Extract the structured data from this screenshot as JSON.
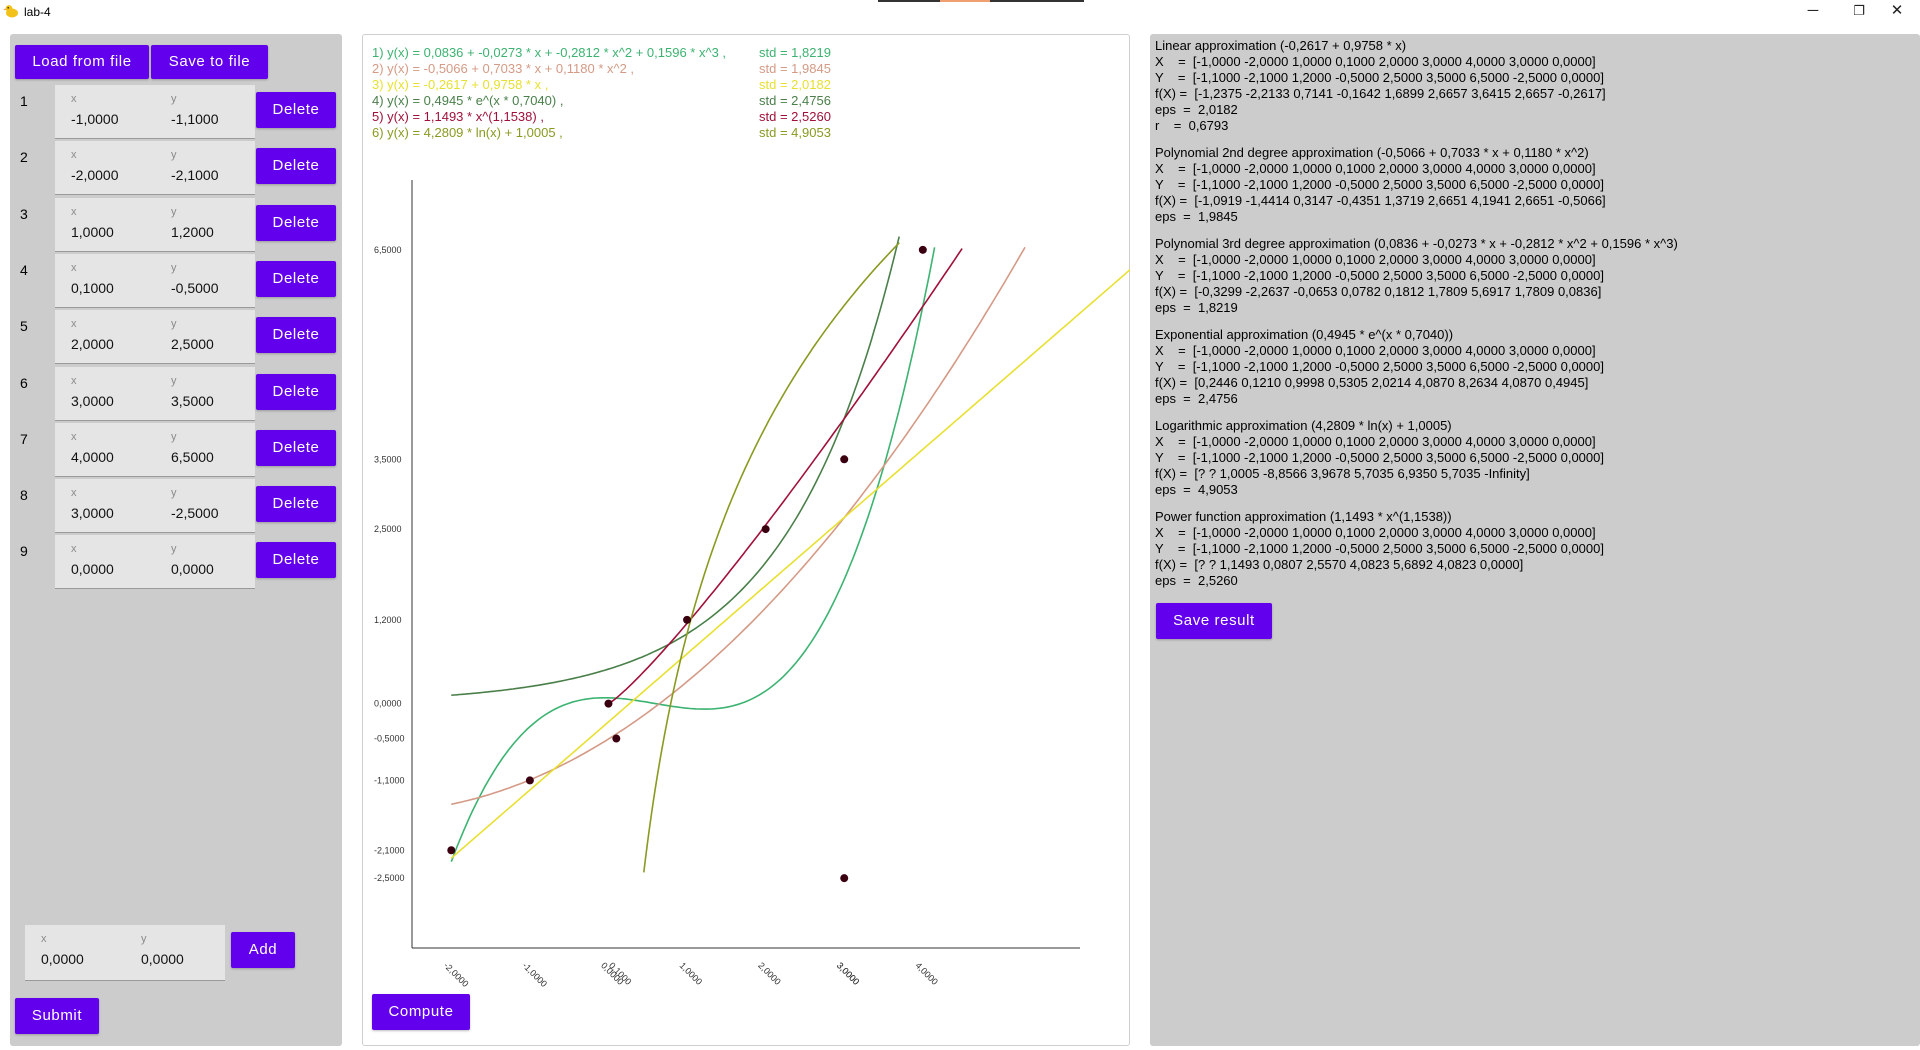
{
  "window": {
    "title": "lab-4",
    "minimize_glyph": "─",
    "restore_glyph": "❐",
    "close_glyph": "✕",
    "app_icon": "duck-icon"
  },
  "left": {
    "load_label": "Load from file",
    "save_label": "Save to file",
    "x_label": "x",
    "y_label": "y",
    "delete_label": "Delete",
    "points": [
      {
        "n": "1",
        "x": "-1,0000",
        "y": "-1,1000"
      },
      {
        "n": "2",
        "x": "-2,0000",
        "y": "-2,1000"
      },
      {
        "n": "3",
        "x": "1,0000",
        "y": "1,2000"
      },
      {
        "n": "4",
        "x": "0,1000",
        "y": "-0,5000"
      },
      {
        "n": "5",
        "x": "2,0000",
        "y": "2,5000"
      },
      {
        "n": "6",
        "x": "3,0000",
        "y": "3,5000"
      },
      {
        "n": "7",
        "x": "4,0000",
        "y": "6,5000"
      },
      {
        "n": "8",
        "x": "3,0000",
        "y": "-2,5000"
      },
      {
        "n": "9",
        "x": "0,0000",
        "y": "0,0000"
      }
    ],
    "new_x": "0,0000",
    "new_y": "0,0000",
    "add_label": "Add",
    "submit_label": "Submit"
  },
  "middle": {
    "legend": [
      {
        "formula": "1) y(x) = 0,0836 + -0,0273 * x + -0,2812 * x^2 + 0,1596 * x^3 ,",
        "std": "std = 1,8219",
        "color": "#3cb371"
      },
      {
        "formula": "2) y(x) = -0,5066 + 0,7033 * x + 0,1180 * x^2 ,",
        "std": "std = 1,9845",
        "color": "#d49a86"
      },
      {
        "formula": "3) y(x) = -0,2617 + 0,9758 * x ,",
        "std": "std = 2,0182",
        "color": "#e8e030"
      },
      {
        "formula": "4) y(x) = 0,4945 * e^(x * 0,7040) ,",
        "std": "std = 2,4756",
        "color": "#4a7f4a"
      },
      {
        "formula": "5) y(x) = 1,1493 * x^(1,1538) ,",
        "std": "std = 2,5260",
        "color": "#a0103a"
      },
      {
        "formula": "6) y(x) = 4,2809 * ln(x) + 1,0005 ,",
        "std": "std = 4,9053",
        "color": "#8a9a20"
      }
    ],
    "compute_label": "Compute"
  },
  "chart_data": {
    "type": "scatter",
    "points": [
      {
        "x": -1,
        "y": -1.1
      },
      {
        "x": -2,
        "y": -2.1
      },
      {
        "x": 1,
        "y": 1.2
      },
      {
        "x": 0.1,
        "y": -0.5
      },
      {
        "x": 2,
        "y": 2.5
      },
      {
        "x": 3,
        "y": 3.5
      },
      {
        "x": 4,
        "y": 6.5
      },
      {
        "x": 3,
        "y": -2.5
      },
      {
        "x": 0,
        "y": 0
      }
    ],
    "x_ticks": [
      "-2,0000",
      "-1,0000",
      "0,1000",
      "0,0000",
      "1,0000",
      "2,0000",
      "3,0000",
      "3,0000",
      "4,0000"
    ],
    "x_tick_values": [
      -2,
      -1,
      0.1,
      0,
      1,
      2,
      3,
      3,
      4
    ],
    "y_ticks": [
      "6,5000",
      "3,5000",
      "2,5000",
      "1,2000",
      "0,0000",
      "-0,5000",
      "-1,1000",
      "-2,1000",
      "-2,5000"
    ],
    "y_tick_values": [
      6.5,
      3.5,
      2.5,
      1.2,
      0,
      -0.5,
      -1.1,
      -2.1,
      -2.5
    ],
    "xlim": [
      -2.5,
      6
    ],
    "ylim": [
      -3.5,
      7.5
    ],
    "series": [
      {
        "color": "#3cb371",
        "kind": "poly3",
        "coef": [
          0.0836,
          -0.0273,
          -0.2812,
          0.1596
        ],
        "range": [
          -2,
          4.15
        ]
      },
      {
        "color": "#d49a86",
        "kind": "poly2",
        "coef": [
          -0.5066,
          0.7033,
          0.118
        ],
        "range": [
          -2,
          5.3
        ]
      },
      {
        "color": "#e8e030",
        "kind": "linear",
        "coef": [
          -0.2617,
          0.9758
        ],
        "range": [
          -2,
          7
        ]
      },
      {
        "color": "#4a7f4a",
        "kind": "exp",
        "coef": [
          0.4945,
          0.704
        ],
        "range": [
          -2,
          3.7
        ]
      },
      {
        "color": "#a0103a",
        "kind": "power",
        "coef": [
          1.1493,
          1.1538
        ],
        "range": [
          0,
          4.5
        ]
      },
      {
        "color": "#8a9a20",
        "kind": "log",
        "coef": [
          4.2809,
          1.0005
        ],
        "range": [
          0.45,
          3.7
        ]
      }
    ],
    "point_color": "#3a0010"
  },
  "right": {
    "blocks": [
      {
        "lines": [
          "Linear approximation (-0,2617 + 0,9758 * x)",
          "X    =  [-1,0000 -2,0000 1,0000 0,1000 2,0000 3,0000 4,0000 3,0000 0,0000]",
          "Y    =  [-1,1000 -2,1000 1,2000 -0,5000 2,5000 3,5000 6,5000 -2,5000 0,0000]",
          "f(X) =  [-1,2375 -2,2133 0,7141 -0,1642 1,6899 2,6657 3,6415 2,6657 -0,2617]",
          "eps  =  2,0182",
          "r    =  0,6793"
        ]
      },
      {
        "lines": [
          "Polynomial 2nd degree approximation (-0,5066 + 0,7033 * x + 0,1180 * x^2)",
          "X    =  [-1,0000 -2,0000 1,0000 0,1000 2,0000 3,0000 4,0000 3,0000 0,0000]",
          "Y    =  [-1,1000 -2,1000 1,2000 -0,5000 2,5000 3,5000 6,5000 -2,5000 0,0000]",
          "f(X) =  [-1,0919 -1,4414 0,3147 -0,4351 1,3719 2,6651 4,1941 2,6651 -0,5066]",
          "eps  =  1,9845"
        ]
      },
      {
        "lines": [
          "Polynomial 3rd degree approximation (0,0836 + -0,0273 * x + -0,2812 * x^2 + 0,1596 * x^3)",
          "X    =  [-1,0000 -2,0000 1,0000 0,1000 2,0000 3,0000 4,0000 3,0000 0,0000]",
          "Y    =  [-1,1000 -2,1000 1,2000 -0,5000 2,5000 3,5000 6,5000 -2,5000 0,0000]",
          "f(X) =  [-0,3299 -2,2637 -0,0653 0,0782 0,1812 1,7809 5,6917 1,7809 0,0836]",
          "eps  =  1,8219"
        ]
      },
      {
        "lines": [
          "Exponential approximation (0,4945 * e^(x * 0,7040))",
          "X    =  [-1,0000 -2,0000 1,0000 0,1000 2,0000 3,0000 4,0000 3,0000 0,0000]",
          "Y    =  [-1,1000 -2,1000 1,2000 -0,5000 2,5000 3,5000 6,5000 -2,5000 0,0000]",
          "f(X) =  [0,2446 0,1210 0,9998 0,5305 2,0214 4,0870 8,2634 4,0870 0,4945]",
          "eps  =  2,4756"
        ]
      },
      {
        "lines": [
          "Logarithmic approximation (4,2809 * ln(x) + 1,0005)",
          "X    =  [-1,0000 -2,0000 1,0000 0,1000 2,0000 3,0000 4,0000 3,0000 0,0000]",
          "Y    =  [-1,1000 -2,1000 1,2000 -0,5000 2,5000 3,5000 6,5000 -2,5000 0,0000]",
          "f(X) =  [? ? 1,0005 -8,8566 3,9678 5,7035 6,9350 5,7035 -Infinity]",
          "eps  =  4,9053"
        ]
      },
      {
        "lines": [
          "Power function approximation (1,1493 * x^(1,1538))",
          "X    =  [-1,0000 -2,0000 1,0000 0,1000 2,0000 3,0000 4,0000 3,0000 0,0000]",
          "Y    =  [-1,1000 -2,1000 1,2000 -0,5000 2,5000 3,5000 6,5000 -2,5000 0,0000]",
          "f(X) =  [? ? 1,1493 0,0807 2,5570 4,0823 5,6892 4,0823 0,0000]",
          "eps  =  2,5260"
        ]
      }
    ],
    "save_result_label": "Save result"
  }
}
